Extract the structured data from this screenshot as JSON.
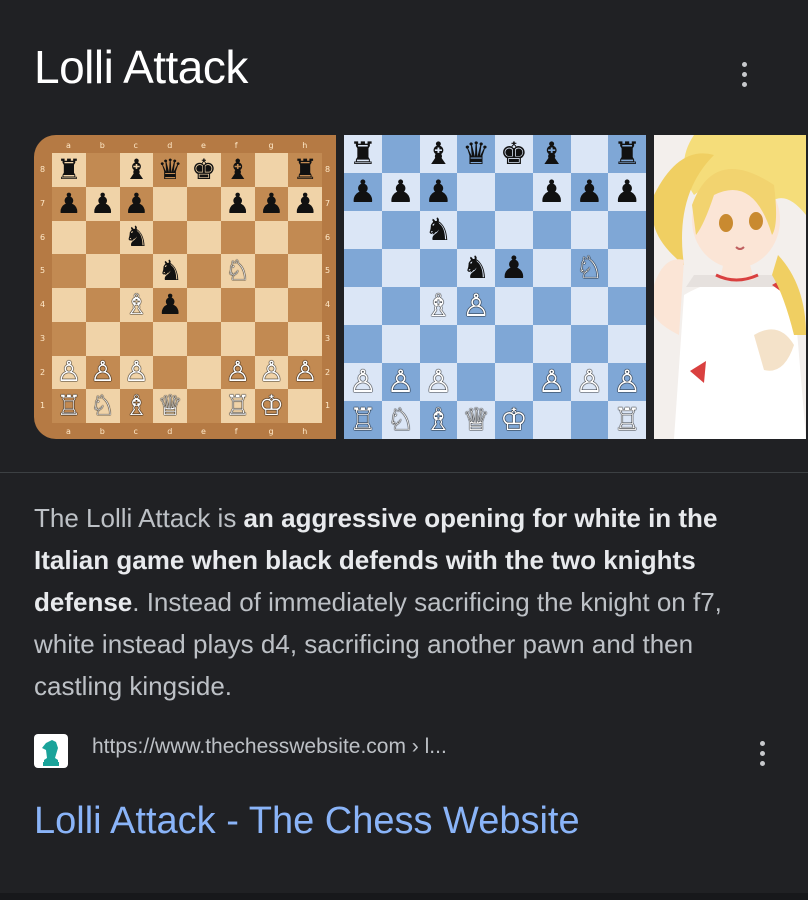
{
  "card": {
    "title": "Lolli Attack",
    "menu_icon": "more-vert-icon"
  },
  "images": {
    "board1": {
      "files": [
        "a",
        "b",
        "c",
        "d",
        "e",
        "f",
        "g",
        "h"
      ],
      "ranks": [
        "8",
        "7",
        "6",
        "5",
        "4",
        "3",
        "2",
        "1"
      ],
      "light_color": "#f0d3a8",
      "dark_color": "#c28a52",
      "rows": [
        [
          "♜",
          "",
          "♝",
          "♛",
          "♚",
          "♝",
          "",
          "♜"
        ],
        [
          "♟",
          "♟",
          "♟",
          "",
          "",
          "♟",
          "♟",
          "♟"
        ],
        [
          "",
          "",
          "♞",
          "",
          "",
          "",
          "",
          ""
        ],
        [
          "",
          "",
          "",
          "♞",
          "",
          "♘",
          "",
          ""
        ],
        [
          "",
          "",
          "♗",
          "♟",
          "",
          "",
          "",
          ""
        ],
        [
          "",
          "",
          "",
          "",
          "",
          "",
          "",
          ""
        ],
        [
          "♙",
          "♙",
          "♙",
          "",
          "",
          "♙",
          "♙",
          "♙"
        ],
        [
          "♖",
          "♘",
          "♗",
          "♕",
          "",
          "♖",
          "♔",
          ""
        ]
      ]
    },
    "board2": {
      "light_color": "#dbe6f6",
      "dark_color": "#7fa7d6",
      "rows": [
        [
          "♜",
          "",
          "♝",
          "♛",
          "♚",
          "♝",
          "",
          "♜"
        ],
        [
          "♟",
          "♟",
          "♟",
          "",
          "",
          "♟",
          "♟",
          "♟"
        ],
        [
          "",
          "",
          "♞",
          "",
          "",
          "",
          "",
          ""
        ],
        [
          "",
          "",
          "",
          "♞",
          "♟",
          "",
          "♘",
          ""
        ],
        [
          "",
          "",
          "♗",
          "♙",
          "",
          "",
          "",
          ""
        ],
        [
          "",
          "",
          "",
          "",
          "",
          "",
          "",
          ""
        ],
        [
          "♙",
          "♙",
          "♙",
          "",
          "",
          "♙",
          "♙",
          "♙"
        ],
        [
          "♖",
          "♘",
          "♗",
          "♕",
          "♔",
          "",
          "",
          "♖"
        ]
      ]
    },
    "anime_image": "anime-character-image"
  },
  "description": {
    "part1": "The Lolli Attack is ",
    "bold": "an aggressive opening for white in the Italian game when black defends with the two knights defense",
    "part2": ". Instead of immediately sacrificing the knight on f7, white instead plays d4, sacrificing another pawn and then castling kingside."
  },
  "source": {
    "icon": "chess-knight-logo-icon",
    "url": "https://www.thechesswebsite.com › l..."
  },
  "result": {
    "title": "Lolli Attack - The Chess Website"
  }
}
